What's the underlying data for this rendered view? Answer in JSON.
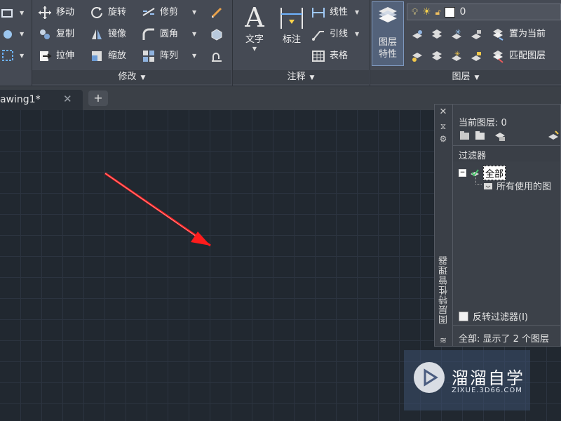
{
  "modify_panel": {
    "title": "修改",
    "tools": {
      "move": "移动",
      "rotate": "旋转",
      "trim": "修剪",
      "copy": "复制",
      "mirror": "镜像",
      "fillet": "圆角",
      "stretch": "拉伸",
      "scale": "缩放",
      "array": "阵列"
    }
  },
  "annotation_panel": {
    "title": "注释",
    "text": "文字",
    "dimension": "标注",
    "linear": "线性",
    "leader": "引线",
    "table": "表格"
  },
  "layers_panel": {
    "title": "图层",
    "layer_properties": "图层\n特性",
    "current_layer_value": "0",
    "set_current": "置为当前",
    "match_layer": "匹配图层"
  },
  "tabs": {
    "drawing_tab": "awing1*"
  },
  "layer_manager": {
    "palette_title": "图层特性管理器",
    "current_layer": "当前图层: 0",
    "filters_header": "过滤器",
    "tree_all": "全部",
    "tree_all_used": "所有使用的图",
    "invert_filter": "反转过滤器(I)",
    "status": "全部: 显示了 2 个图层"
  },
  "watermark": {
    "brand": "溜溜自学",
    "url": "ZIXUE.3D66.COM"
  },
  "colors": {
    "arrow": "#ff1c1c",
    "background": "#212830",
    "ribbon": "#454a54"
  }
}
